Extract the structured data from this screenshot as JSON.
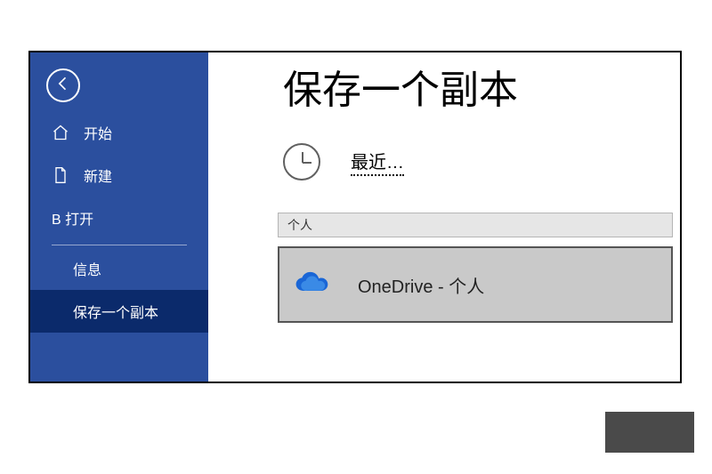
{
  "sidebar": {
    "items": [
      {
        "label": "开始"
      },
      {
        "label": "新建"
      },
      {
        "label": "B 打开"
      },
      {
        "label": "信息"
      },
      {
        "label": "保存一个副本"
      }
    ]
  },
  "main": {
    "title": "保存一个副本",
    "recent_label": "最近…",
    "section_header": "个人",
    "location_label": "OneDrive - 个人"
  }
}
